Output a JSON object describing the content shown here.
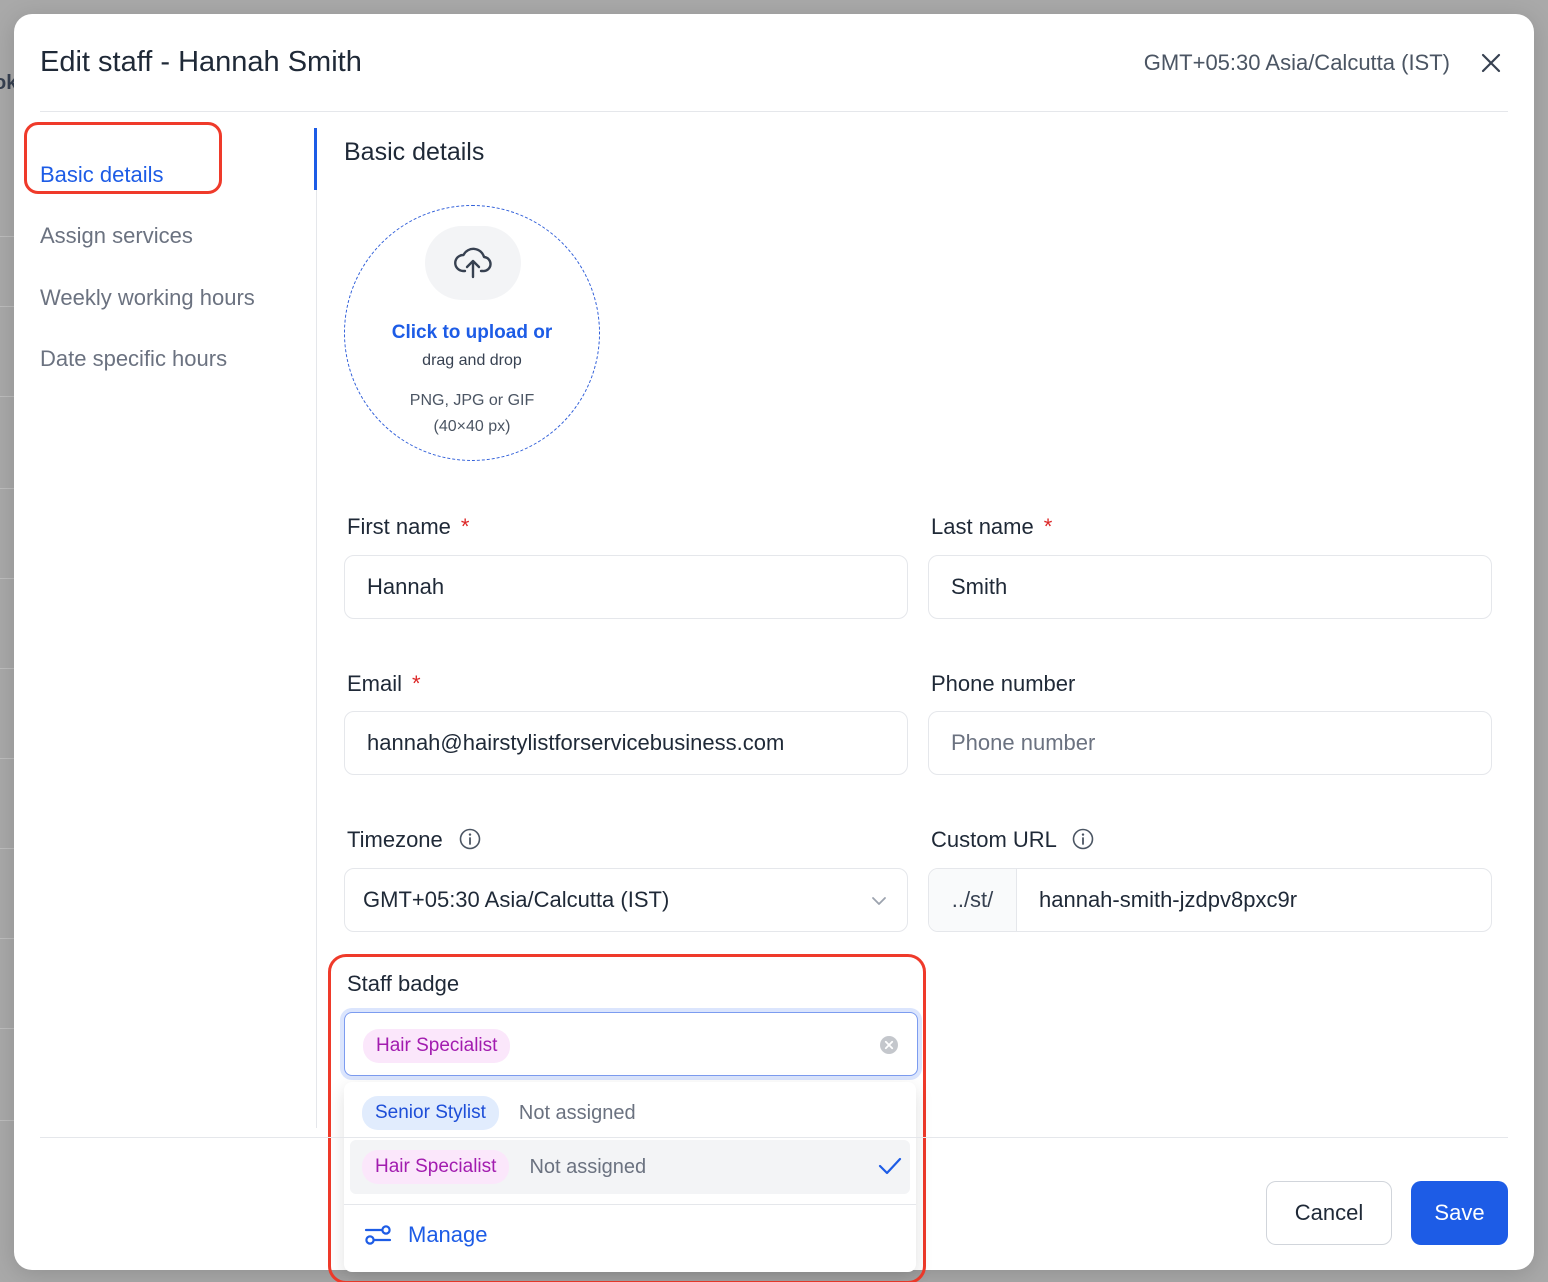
{
  "backdrop": {
    "edge_text": "ok"
  },
  "header": {
    "title": "Edit staff - Hannah Smith",
    "timezone": "GMT+05:30 Asia/Calcutta (IST)",
    "close_icon": "close-icon"
  },
  "nav": {
    "items": [
      {
        "label": "Basic details",
        "active": true
      },
      {
        "label": "Assign services",
        "active": false
      },
      {
        "label": "Weekly working hours",
        "active": false
      },
      {
        "label": "Date specific hours",
        "active": false
      }
    ]
  },
  "section": {
    "title": "Basic details"
  },
  "upload": {
    "icon": "cloud-upload-icon",
    "main": "Click to upload or",
    "sub": "drag and drop",
    "types": "PNG, JPG or GIF",
    "size": "(40×40 px)"
  },
  "fields": {
    "first_name": {
      "label": "First name",
      "required": "*",
      "value": "Hannah"
    },
    "last_name": {
      "label": "Last name",
      "required": "*",
      "value": "Smith"
    },
    "email": {
      "label": "Email",
      "required": "*",
      "value": "hannah@hairstylistforservicebusiness.com"
    },
    "phone": {
      "label": "Phone number",
      "placeholder": "Phone number"
    },
    "timezone": {
      "label": "Timezone",
      "value": "GMT+05:30 Asia/Calcutta (IST)"
    },
    "custom_url": {
      "label": "Custom URL",
      "prefix": "../st/",
      "value": "hannah-smith-jzdpv8pxc9r"
    }
  },
  "staff_badge": {
    "label": "Staff badge",
    "selected": "Hair Specialist",
    "options": [
      {
        "name": "Senior Stylist",
        "status": "Not assigned",
        "color": "blue",
        "selected": false
      },
      {
        "name": "Hair Specialist",
        "status": "Not assigned",
        "color": "pink",
        "selected": true
      }
    ],
    "manage_label": "Manage"
  },
  "footer": {
    "cancel": "Cancel",
    "save": "Save"
  },
  "colors": {
    "accent": "#1d5ce6",
    "highlight": "#ef3a2a",
    "pill_pink_text": "#a21caf",
    "pill_blue_text": "#1d4ed8"
  }
}
